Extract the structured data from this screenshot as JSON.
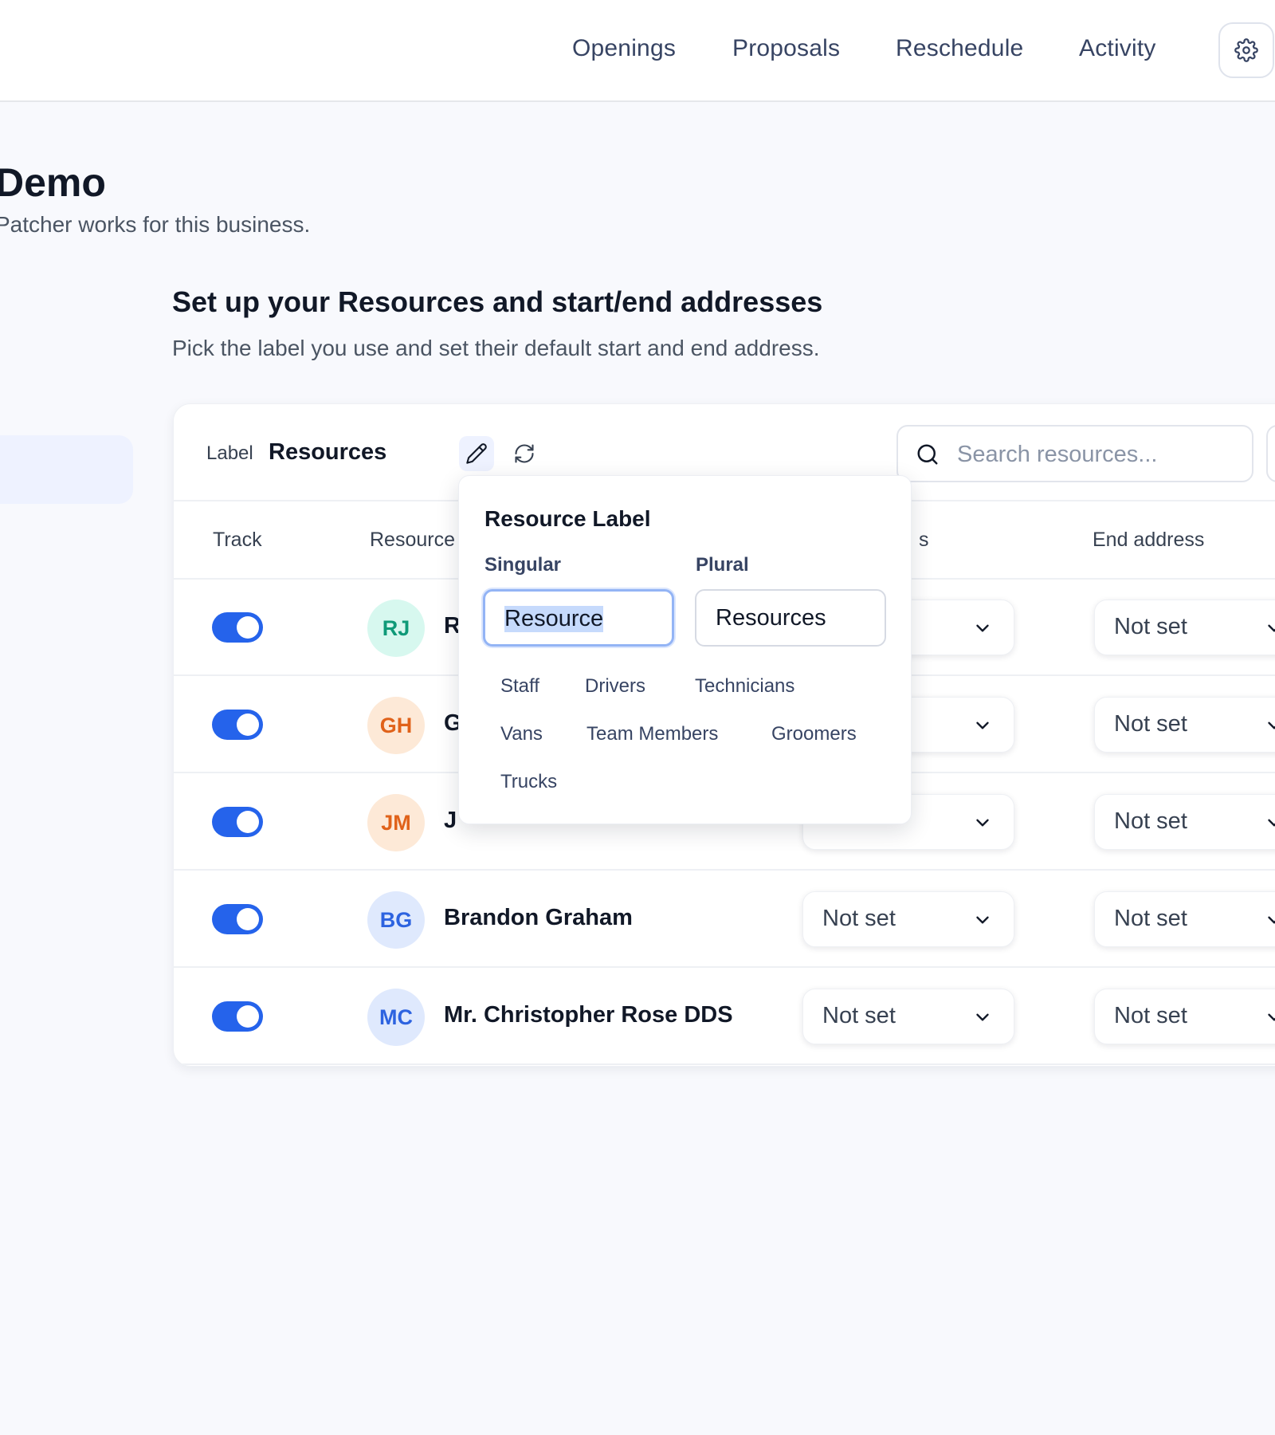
{
  "nav": {
    "items": [
      "Openings",
      "Proposals",
      "Reschedule",
      "Activity"
    ],
    "settings_icon": "gear-icon"
  },
  "page": {
    "title": "Demo",
    "subtitle": "Patcher works for this business."
  },
  "section": {
    "title": "Set up your Resources and start/end addresses",
    "subtitle": "Pick the label you use and set their default start and end address."
  },
  "toolbar": {
    "label_caption": "Label",
    "label_value": "Resources",
    "edit_icon": "pencil-icon",
    "refresh_icon": "refresh-icon",
    "search_placeholder": "Search resources..."
  },
  "table": {
    "headers": {
      "track": "Track",
      "resource": "Resource",
      "start_fragment": "s",
      "end": "End address"
    },
    "rows": [
      {
        "initials": "RJ",
        "name": "R",
        "start": "",
        "end": "Not set",
        "tracked": true,
        "avatar_bg": "#d7f8ef",
        "avatar_fg": "#0f9a78"
      },
      {
        "initials": "GH",
        "name": "G",
        "start": "",
        "end": "Not set",
        "tracked": true,
        "avatar_bg": "#fde9d7",
        "avatar_fg": "#e0621a"
      },
      {
        "initials": "JM",
        "name": "J",
        "start": "",
        "end": "Not set",
        "tracked": true,
        "avatar_bg": "#fde9d7",
        "avatar_fg": "#e0621a"
      },
      {
        "initials": "BG",
        "name": "Brandon Graham",
        "start": "Not set",
        "end": "Not set",
        "tracked": true,
        "avatar_bg": "#dfe9fd",
        "avatar_fg": "#2d63e0"
      },
      {
        "initials": "MC",
        "name": "Mr. Christopher Rose DDS",
        "start": "Not set",
        "end": "Not set",
        "tracked": true,
        "avatar_bg": "#dfe9fd",
        "avatar_fg": "#2d63e0"
      }
    ]
  },
  "popover": {
    "title": "Resource Label",
    "singular_label": "Singular",
    "plural_label": "Plural",
    "singular_value": "Resource",
    "plural_value": "Resources",
    "suggestions": [
      "Staff",
      "Drivers",
      "Technicians",
      "Vans",
      "Team Members",
      "Groomers",
      "Trucks"
    ]
  },
  "colors": {
    "accent": "#2563eb",
    "background": "#f8f9fd"
  }
}
